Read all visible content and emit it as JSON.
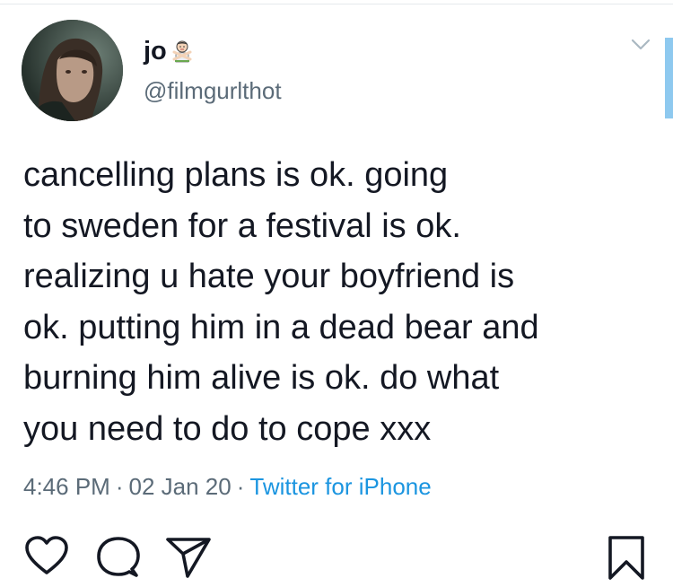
{
  "tweet": {
    "display_name": "jo",
    "name_emoji_icon": "person-gesturing-no-emoji",
    "handle": "@filmgurlthot",
    "text": "cancelling plans is ok. going\nto sweden for a festival is ok.\nrealizing u hate your boyfriend is\nok. putting him in a dead bear and\nburning him alive is ok. do what\nyou need to do to cope xxx",
    "time": "4:46 PM",
    "date": "02 Jan 20",
    "separator": "·",
    "source": "Twitter for iPhone",
    "menu_icon": "chevron-down-icon"
  },
  "actions": {
    "icons": [
      "heart-icon",
      "comment-icon",
      "share-icon",
      "bookmark-icon"
    ]
  },
  "colors": {
    "text": "#141823",
    "muted": "#5b6b78",
    "link": "#1b95e0",
    "accent": "#8ec9ef"
  }
}
